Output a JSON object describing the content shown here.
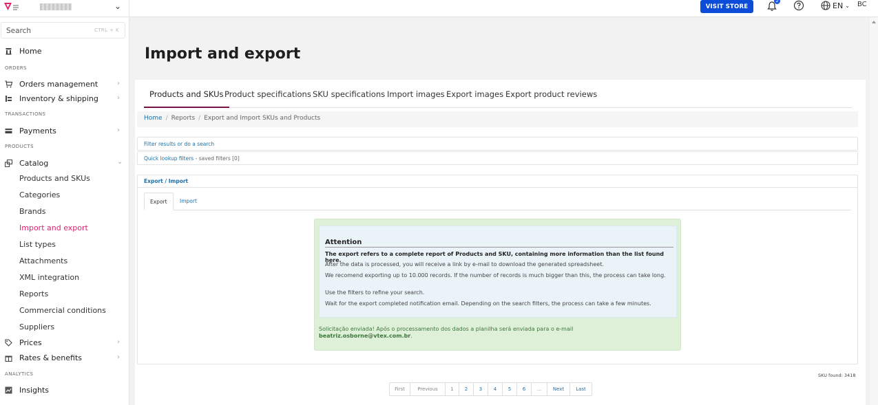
{
  "topbar": {
    "visit_store": "VISIT STORE",
    "notification_count": "2",
    "language": "EN",
    "user_initials": "BC"
  },
  "sidebar": {
    "search_placeholder": "Search",
    "search_shortcut": "CTRL + K",
    "home": "Home",
    "sections": {
      "orders": "ORDERS",
      "transactions": "TRANSACTIONS",
      "products": "PRODUCTS",
      "analytics": "ANALYTICS"
    },
    "orders_management": "Orders management",
    "inventory_shipping": "Inventory & shipping",
    "payments": "Payments",
    "catalog": "Catalog",
    "catalog_items": [
      "Products and SKUs",
      "Categories",
      "Brands",
      "Import and export",
      "List types",
      "Attachments",
      "XML integration",
      "Reports",
      "Commercial conditions",
      "Suppliers"
    ],
    "prices": "Prices",
    "rates_benefits": "Rates & benefits",
    "insights": "Insights"
  },
  "main": {
    "title": "Import and export",
    "tabs": [
      "Products and SKUs",
      "Product specifications",
      "SKU specifications",
      "Import images",
      "Export images",
      "Export product reviews"
    ],
    "breadcrumb": [
      "Home",
      "Reports",
      "Export and Import SKUs and Products"
    ],
    "filter_link": "Filter results or do a search",
    "quick_lookup_link": "Quick lookup filters",
    "saved_filters": " - saved filters [0]",
    "panel_title": "Export / Import",
    "subtabs": [
      "Export",
      "Import"
    ],
    "attention": {
      "title": "Attention",
      "lines": [
        "The export refers to a complete report of Products and SKU, containing more information than the list found here.",
        "After the data is processed, you will receive a link by e-mail to download the generated spreadsheet.",
        "We recomend exporting up to 10.000 records. If the number of records is much bigger than this, the process can take long.",
        "Use the filters to refine your search.",
        "Wait for the export completed notification email. Depending on the search filters, the process can take a few minutes."
      ]
    },
    "success_message": "Solicitação enviada! Após o processamento dos dados a planilha será enviada para o e-mail",
    "success_email": "beatriz.osborne@vtex.com.br",
    "sku_found": "SKU found: 3418",
    "pagination": [
      "First",
      "Previous",
      "1",
      "2",
      "3",
      "4",
      "5",
      "6",
      "...",
      "Next",
      "Last"
    ]
  },
  "colors": {
    "brand_pink": "#e11f6a",
    "primary_blue": "#0b4dd8",
    "link_blue": "#1d6fa6",
    "success_green_bg": "#dff0d8",
    "active_tab_underline": "#7a1048"
  }
}
